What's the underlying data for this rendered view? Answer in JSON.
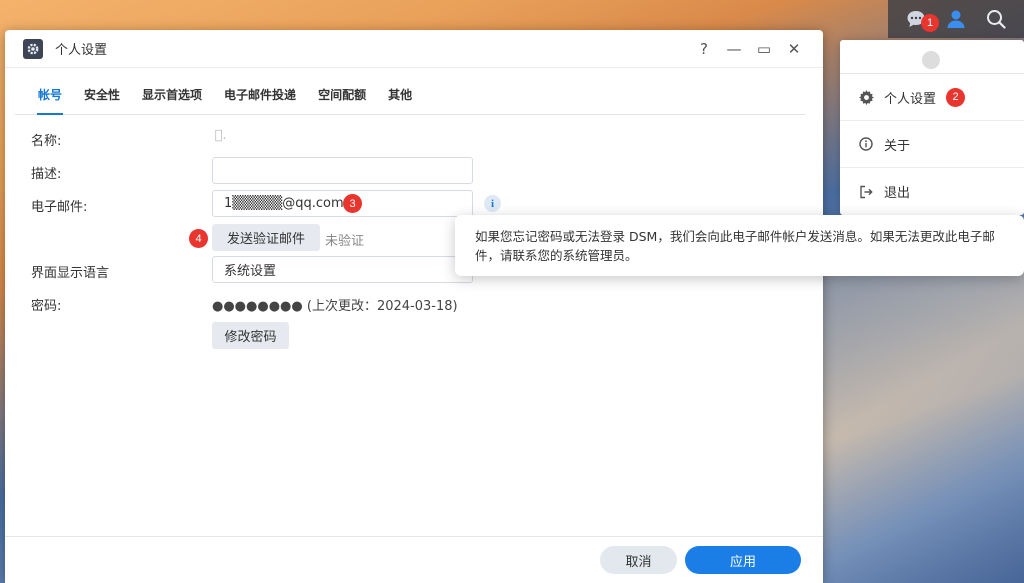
{
  "window": {
    "title": "个人设置",
    "help": "?",
    "minimize": "—",
    "maximize": "▭",
    "close": "✕"
  },
  "tabs": [
    {
      "label": "帐号",
      "active": true
    },
    {
      "label": "安全性"
    },
    {
      "label": "显示首选项"
    },
    {
      "label": "电子邮件投递"
    },
    {
      "label": "空间配额"
    },
    {
      "label": "其他"
    }
  ],
  "form": {
    "name_label": "名称:",
    "name_value": " ﾞ.",
    "desc_label": "描述:",
    "desc_value": "",
    "email_label": "电子邮件:",
    "email_value": "1▒▒▒▒▒@qq.com",
    "email_badge": "3",
    "info_icon": "i",
    "send_badge": "4",
    "send_button": "发送验证邮件",
    "unverified": "未验证",
    "lang_label": "界面显示语言",
    "lang_value": "系统设置",
    "pwd_label": "密码:",
    "pwd_value": "●●●●●●●● (上次更改：2024-03-18)",
    "change_pwd_button": "修改密码"
  },
  "footer": {
    "cancel": "取消",
    "apply": "应用"
  },
  "topbar": {
    "chat_badge": "1"
  },
  "menu": {
    "user": " ",
    "items": [
      {
        "label": "个人设置",
        "icon": "gear-icon",
        "badge": "2"
      },
      {
        "label": "关于",
        "icon": "info-icon"
      },
      {
        "label": "退出",
        "icon": "logout-icon"
      }
    ]
  },
  "tooltip": {
    "text": "如果您忘记密码或无法登录 DSM，我们会向此电子邮件帐户发送消息。如果无法更改此电子邮件，请联系您的系统管理员。"
  },
  "colors": {
    "accent": "#1478d4",
    "badge": "#e8352d",
    "apply": "#1a7ee6"
  }
}
